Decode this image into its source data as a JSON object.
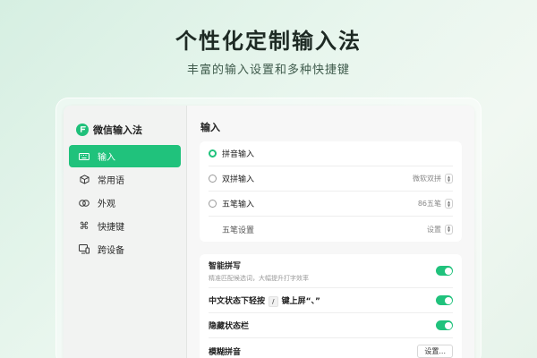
{
  "hero": {
    "title": "个性化定制输入法",
    "subtitle": "丰富的输入设置和多种快捷键"
  },
  "colors": {
    "accent": "#20c27c",
    "sidebar_bg": "#f2f3f2",
    "main_bg": "#f7f7f7"
  },
  "sidebar": {
    "app_name": "微信输入法",
    "items": [
      {
        "label": "输入",
        "icon": "keyboard-icon",
        "active": true
      },
      {
        "label": "常用语",
        "icon": "cube-icon",
        "active": false
      },
      {
        "label": "外观",
        "icon": "rings-icon",
        "active": false
      },
      {
        "label": "快捷键",
        "icon": "command-icon",
        "active": false
      },
      {
        "label": "跨设备",
        "icon": "devices-icon",
        "active": false
      }
    ]
  },
  "main": {
    "section_title": "输入",
    "input_methods": {
      "pinyin": {
        "label": "拼音输入",
        "selected": true
      },
      "shuangpin": {
        "label": "双拼输入",
        "value": "微软双拼"
      },
      "wubi": {
        "label": "五笔输入",
        "value": "86五笔"
      },
      "wubi_settings": {
        "label": "五笔设置",
        "value": "设置"
      }
    },
    "options": {
      "smart_spelling": {
        "label": "智能拼写",
        "description": "精准匹配候选词，大幅提升打字效率",
        "enabled": true
      },
      "chinese_key": {
        "label_before": "中文状态下轻按",
        "key": "/",
        "label_after": "键上屏“、”",
        "enabled": true
      },
      "hide_statusbar": {
        "label": "隐藏状态栏",
        "enabled": true
      },
      "fuzzy_pinyin": {
        "label": "模糊拼音",
        "button": "设置..."
      }
    }
  }
}
